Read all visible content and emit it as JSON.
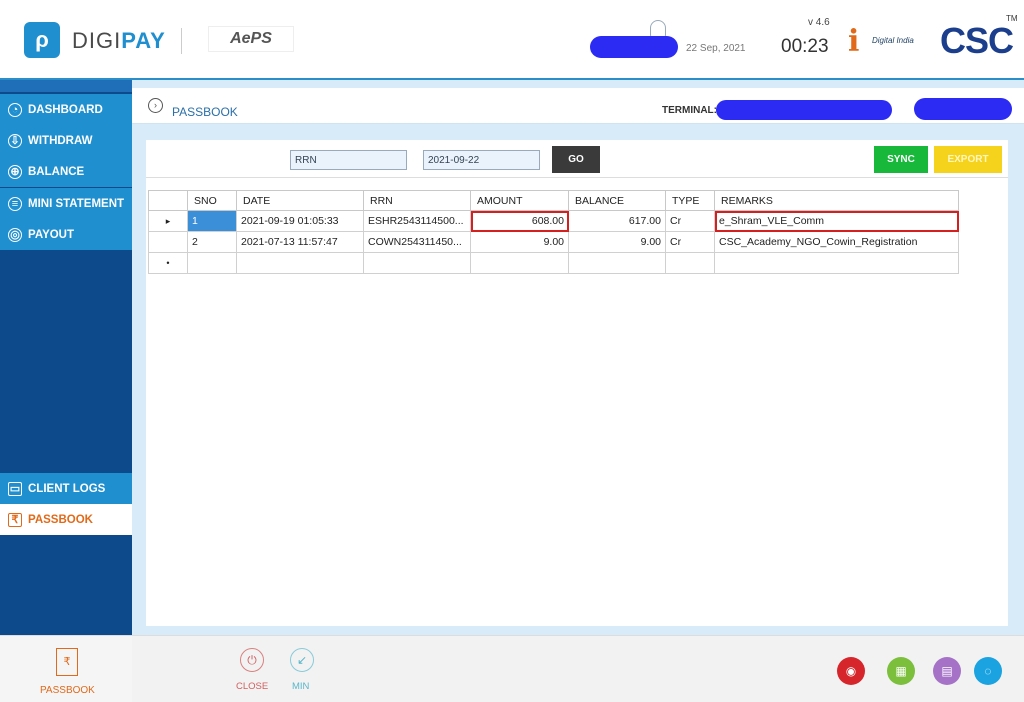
{
  "header": {
    "logo_glyph": "ρ",
    "brand_part1": "DIGI",
    "brand_part2": "PAY",
    "aeps_logo": "AePS",
    "date": "22 Sep, 2021",
    "version": "v 4.6",
    "time": "00:23",
    "digital_india_glyph": "i",
    "digital_india_text": "Digital India",
    "csc_logo": "CSC",
    "trademark": "TM"
  },
  "sidebar": {
    "items": [
      {
        "label": "DASHBOARD",
        "icon": "dashboard-icon",
        "glyph": "◔"
      },
      {
        "label": "WITHDRAW",
        "icon": "withdraw-icon",
        "glyph": "⇩"
      },
      {
        "label": "BALANCE",
        "icon": "balance-icon",
        "glyph": "⊕"
      },
      {
        "label": "MINI STATEMENT",
        "icon": "mini-statement-icon",
        "glyph": "≡"
      },
      {
        "label": "PAYOUT",
        "icon": "payout-icon",
        "glyph": "◎"
      }
    ],
    "client_logs": {
      "label": "CLIENT LOGS",
      "glyph": "▭"
    },
    "passbook": {
      "label": "PASSBOOK",
      "glyph": "₹"
    }
  },
  "titlebar": {
    "title": "PASSBOOK",
    "terminal_label": "TERMINAL:"
  },
  "filter": {
    "rrn_value": "RRN",
    "date_value": "2021-09-22",
    "go_label": "GO",
    "sync_label": "SYNC",
    "export_label": "EXPORT"
  },
  "table": {
    "headers": [
      "SNO",
      "DATE",
      "RRN",
      "AMOUNT",
      "BALANCE",
      "TYPE",
      "REMARKS"
    ],
    "rows": [
      [
        "1",
        "2021-09-19 01:05:33",
        "ESHR2543114500...",
        "608.00",
        "617.00",
        "Cr",
        "e_Shram_VLE_Comm"
      ],
      [
        "2",
        "2021-07-13 11:57:47",
        "COWN254311450...",
        "9.00",
        "9.00",
        "Cr",
        "CSC_Academy_NGO_Cowin_Registration"
      ]
    ],
    "current_row_marker": "▸",
    "new_row_marker": "•"
  },
  "footer": {
    "passbook_label": "PASSBOOK",
    "passbook_glyph": "₹",
    "close_label": "CLOSE",
    "close_glyph": "⏻",
    "min_label": "MIN",
    "min_glyph": "↙",
    "icons": [
      {
        "name": "eye-icon",
        "glyph": "◉",
        "color": "#d7262b"
      },
      {
        "name": "fingerprint-icon",
        "glyph": "▦",
        "color": "#7cbf3d"
      },
      {
        "name": "document-icon",
        "glyph": "▤",
        "color": "#a672c8"
      },
      {
        "name": "support-icon",
        "glyph": "◌",
        "color": "#1aa3e0"
      }
    ]
  },
  "colors": {
    "accent": "#1f8fcf",
    "sidebar_dark": "#0d4a8c",
    "highlight_border": "#d62020"
  }
}
